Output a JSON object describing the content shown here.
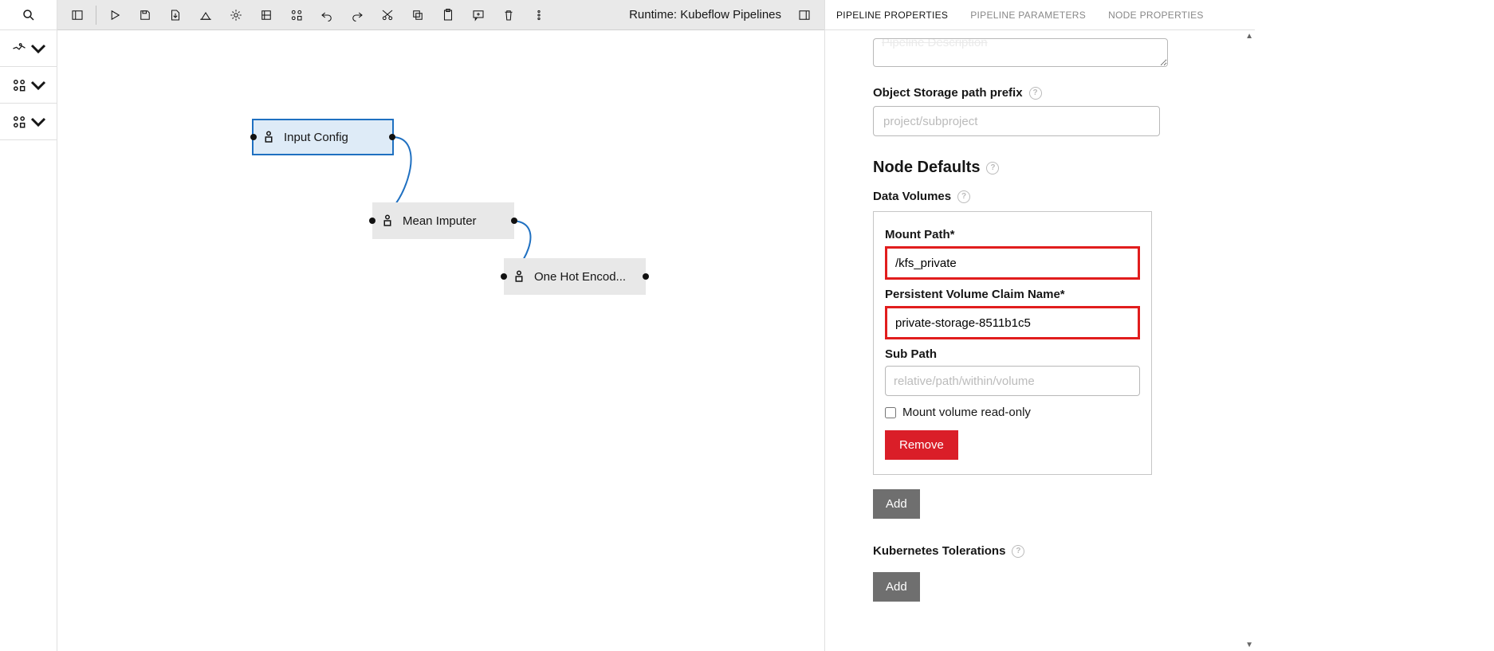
{
  "toolbar": {
    "runtime_label": "Runtime: Kubeflow Pipelines"
  },
  "canvas": {
    "nodes": {
      "n1": {
        "label": "Input Config"
      },
      "n2": {
        "label": "Mean Imputer"
      },
      "n3": {
        "label": "One Hot Encod..."
      }
    }
  },
  "panel": {
    "tabs": {
      "t1": "PIPELINE PROPERTIES",
      "t2": "PIPELINE PARAMETERS",
      "t3": "NODE PROPERTIES"
    },
    "desc_placeholder_partial": "Pipeline Description",
    "obj_store_label": "Object Storage path prefix",
    "obj_store_placeholder": "project/subproject",
    "node_defaults_heading": "Node Defaults",
    "data_volumes_label": "Data Volumes",
    "mount_path_label": "Mount Path*",
    "mount_path_value": "/kfs_private",
    "pvc_label": "Persistent Volume Claim Name*",
    "pvc_value": "private-storage-8511b1c5",
    "subpath_label": "Sub Path",
    "subpath_placeholder": "relative/path/within/volume",
    "readonly_label": "Mount volume read-only",
    "remove_btn": "Remove",
    "add_btn": "Add",
    "tolerations_label": "Kubernetes Tolerations",
    "help_q": "?"
  }
}
